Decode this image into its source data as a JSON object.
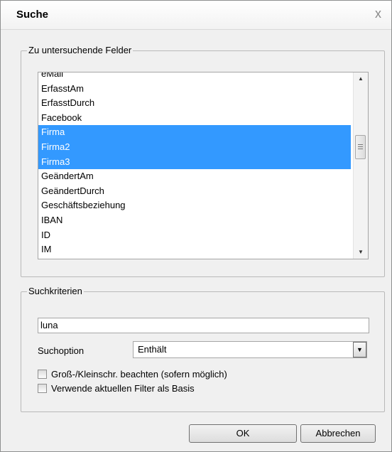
{
  "dialog": {
    "title": "Suche",
    "close_glyph": "x"
  },
  "fields_group": {
    "legend": "Zu untersuchende Felder",
    "items": [
      {
        "label": "eMail",
        "selected": false
      },
      {
        "label": "ErfasstAm",
        "selected": false
      },
      {
        "label": "ErfasstDurch",
        "selected": false
      },
      {
        "label": "Facebook",
        "selected": false
      },
      {
        "label": "Firma",
        "selected": true
      },
      {
        "label": "Firma2",
        "selected": true
      },
      {
        "label": "Firma3",
        "selected": true
      },
      {
        "label": "GeändertAm",
        "selected": false
      },
      {
        "label": "GeändertDurch",
        "selected": false
      },
      {
        "label": "Geschäftsbeziehung",
        "selected": false
      },
      {
        "label": "IBAN",
        "selected": false
      },
      {
        "label": "ID",
        "selected": false
      },
      {
        "label": "IM",
        "selected": false
      }
    ],
    "selection_color": "#3399ff"
  },
  "criteria_group": {
    "legend": "Suchkriterien",
    "search_value": "luna",
    "search_option_label": "Suchoption",
    "search_option_value": "Enthält",
    "checkbox_case": {
      "label": "Groß-/Kleinschr. beachten (sofern möglich)",
      "checked": false
    },
    "checkbox_filter": {
      "label": "Verwende aktuellen Filter als Basis",
      "checked": false
    }
  },
  "buttons": {
    "ok": "OK",
    "cancel": "Abbrechen"
  }
}
